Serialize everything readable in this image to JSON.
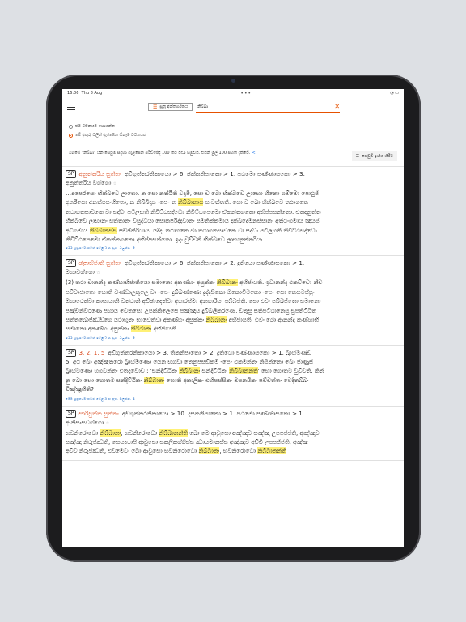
{
  "status_bar": {
    "time": "16:06",
    "date": "Thu 8 Aug",
    "dots": "•••"
  },
  "toolbar": {
    "contents_label": "සූත්‍ර අන්තර්ගතය",
    "search_value": "නිබ්බා",
    "clear": "✕"
  },
  "options": [
    {
      "label": "එම වචනයම සොයන්න",
      "selected": false
    },
    {
      "label": "මේ අකුරු වලින් ඇරඹෙන ඕනෑම වචනයක්",
      "selected": true
    }
  ],
  "info": {
    "text": "ඔබගේ \"නිබ්බා\" යන සෙවුම සඳහා ගැළපෙන පරිච්ඡේද 100 කට වඩා හමුවිය. එයින් මුල් 100 පහත දැක්වේ.",
    "link_icon": "<",
    "more_button": "සෙවුම් ඉඟිය හීරීම"
  },
  "results": [
    {
      "title": "අනුත්තරිය සුත්තං",
      "path": "අඞ්ගුත්තරනිකායො > 6. ඡක්කනිපාතො > 1. පඨමො පණ්ණාසකො > 3.",
      "line2": "අනුත්තරිය වග්ගො",
      "star": "☆",
      "lines": [
        [
          {
            "t": "…අපෙරසො භික්ඛවෙ ලාභො. න සො නත්ථීති වදාමි, සො ච ඛො භික්ඛවෙ ලාභො හීනො ගම්මො පොථුජ්"
          }
        ],
        [
          {
            "t": "අනරියො අනත්ථසංහිතො, න නිබ්බිදාය -පෙ- න "
          },
          {
            "t": "නිබ්බානාය",
            "h": true
          },
          {
            "t": " සංවත්තති. යො ච ඛො භික්ඛවෙ තථාගතෙ"
          }
        ],
        [
          {
            "t": "තථාගතසාවකෙ වා සද්ධං පටිලභති නිවිට්ඨසද්ධො නිවිට්ඨපෙමො ඒකන්තගතො අභිප්පසන්නො. එතදනුත්ත"
          }
        ],
        [
          {
            "t": "භික්ඛවෙ ලාභානං සත්තානං විසුද්ධියා සොකපරිද්දවානං සමතික්කමාය දුක්ඛදොමනස්සානං අත්ථංගමාය ඤායස්"
          }
        ],
        [
          {
            "t": "අධිගමාය "
          },
          {
            "t": "නිබ්බානස්ස",
            "h": true
          },
          {
            "t": " සච්ඡිකිරියාය, යදිදං තථාගතෙ වා තථාගතසාවකෙ වා සද්ධං පටිලභති නිවිට්ඨසද්ධො"
          }
        ],
        [
          {
            "t": "නිවිට්ඨපෙමො ඒකන්තගතො අභිප්පසන්නො. ඉදං වුච්චති භික්ඛවෙ ලාභානුත්තරියං."
          }
        ]
      ],
      "footer": "මෙම සූත්‍රයේම තවත් මේළී 3 ක ඇත. බලන්න."
    },
    {
      "title": "ඡළාභිජාති සුත්තං",
      "path": "අඞ්ගුත්තරනිකායො > 6. ඡක්කනිපාතො > 2. දුතියො පණ්ණාසකො > 1.",
      "line2": "මහාවග්ගො",
      "star": "☆",
      "lines": [
        [
          {
            "t": "(3) තථා චානන්ද කණ්හාභිජාතියො සමානො අකණ්හං අසුක්කං "
          },
          {
            "t": "නිබ්බානං",
            "h": true
          },
          {
            "t": " අභිජායති. ඉධානන්ද එකච්චො නීච"
          }
        ],
        [
          {
            "t": "පච්චාජාතො හොති චණ්ඩාලකුලෙ වා -පෙ- දුබ්බණ්ණො දුද්දසිකො ඔකොටිමකො -පෙ- සො කෙසමස්සුං"
          }
        ],
        [
          {
            "t": "ඔහාරෙත්වා කාසායානි වත්ථානි අච්ඡාදෙත්වා අගාරස්මා අනගාරියං පබ්බජති. සො එවං පබ්බජිතො සමානො"
          }
        ],
        [
          {
            "t": "පඤ්චනීවරණෙ පහාය චෙතසො උපක්කිලෙසෙ පඤ්ඤාය දුබ්බලීකරණෙ, චතූසු සතිපට්ඨානෙසු සුපතිට්ඨිත"
          }
        ],
        [
          {
            "t": "සත්තබොජ්ඣඞ්ගෙ යථාභූතං භාවෙත්වා අකණ්හං අසුක්කං "
          },
          {
            "t": "නිබ්බානං",
            "h": true
          },
          {
            "t": " අභිජායති. එවං ඛො ආනන්ද කණ්හාභි"
          }
        ],
        [
          {
            "t": "සමානො අකණ්හං අසුක්කං "
          },
          {
            "t": "නිබ්බානං",
            "h": true
          },
          {
            "t": " අභිජායති."
          }
        ]
      ],
      "footer": "මෙම සූත්‍රයේම තවත් මේළී 2 ක ඇත. බලන්න."
    },
    {
      "title": "3. 2. 1. 5",
      "path": "අඞ්ගුත්තරනිකායො > 3. තිකනිපාතො > 2. දුතියො පණ්ණාසකො > 1. බ්‍රාහ්මණ්ඩ",
      "line2": "",
      "star": "",
      "lines": [
        [
          {
            "t": "5. අථ ඛො අඤ්ඤතරො බ්‍රාහ්මණො යෙන භගවා තෙනුපසඞ්කමි -පෙ- එකමන්තං නිසින්නො ඛො ජාණුස්"
          }
        ],
        [
          {
            "t": "බ්‍රාහ්මණො භගවන්තං එතදවොච : 'සන්දිට්ඨිකං "
          },
          {
            "t": "නිබ්බානං",
            "h": true
          },
          {
            "t": " සන්දිට්ඨිකං "
          },
          {
            "t": "නිබ්බානන්ති",
            "h": true
          },
          {
            "t": "' භො ගොතම වුච්චති. කිත්"
          }
        ],
        [
          {
            "t": "නු ඛො භො ගොතම සන්දිට්ඨිකං "
          },
          {
            "t": "නිබ්බානං",
            "h": true
          },
          {
            "t": " හොති අකාලිකං එහිපස්සිකං ඔපනයිකං පච්චත්තං වෙදිතබ්බං"
          }
        ],
        [
          {
            "t": "විඤ්ඤූහීති?"
          }
        ]
      ],
      "footer": "මෙම සූත්‍රයේම තවත් මේළී 3 ක ඇත. බලන්න."
    },
    {
      "title": "සාරිපුත්ත සුත්තං",
      "path": "අඞ්ගුත්තරනිකායො > 10. දසකනිපාතො > 1. පඨමො පණ්ණාසකො > 1.",
      "line2": "ආනිසංසවග්ගො",
      "star": "☆",
      "lines": [
        [
          {
            "t": "භවනිරොධො "
          },
          {
            "t": "නිබ්බානං",
            "h": true
          },
          {
            "t": ", භවනිරොධො "
          },
          {
            "t": "නිබ්බානන්ති",
            "h": true
          },
          {
            "t": " ඛො මෙ ආවුසො අඤ්ඤාව සඤ්ඤා උපපජ්ජති, අඤ්ඤාව"
          }
        ],
        [
          {
            "t": "සඤ්ඤා නිරුජ්ඣති, සෙය්‍යථාපි ආවුසො සකලිකග්ගිස්ස ඣායමානස්ස අඤ්ඤාව අච්චි උපපජ්ජති, අඤ්ඤ"
          }
        ],
        [
          {
            "t": "අච්චි නිරුජ්ඣති, එවමෙවං ඛො ආවුසො භවනිරොධො "
          },
          {
            "t": "නිබ්බානං",
            "h": true
          },
          {
            "t": ", භවනිරොධො "
          },
          {
            "t": "නිබ්බානන්ති",
            "h": true
          }
        ]
      ],
      "footer": ""
    }
  ]
}
